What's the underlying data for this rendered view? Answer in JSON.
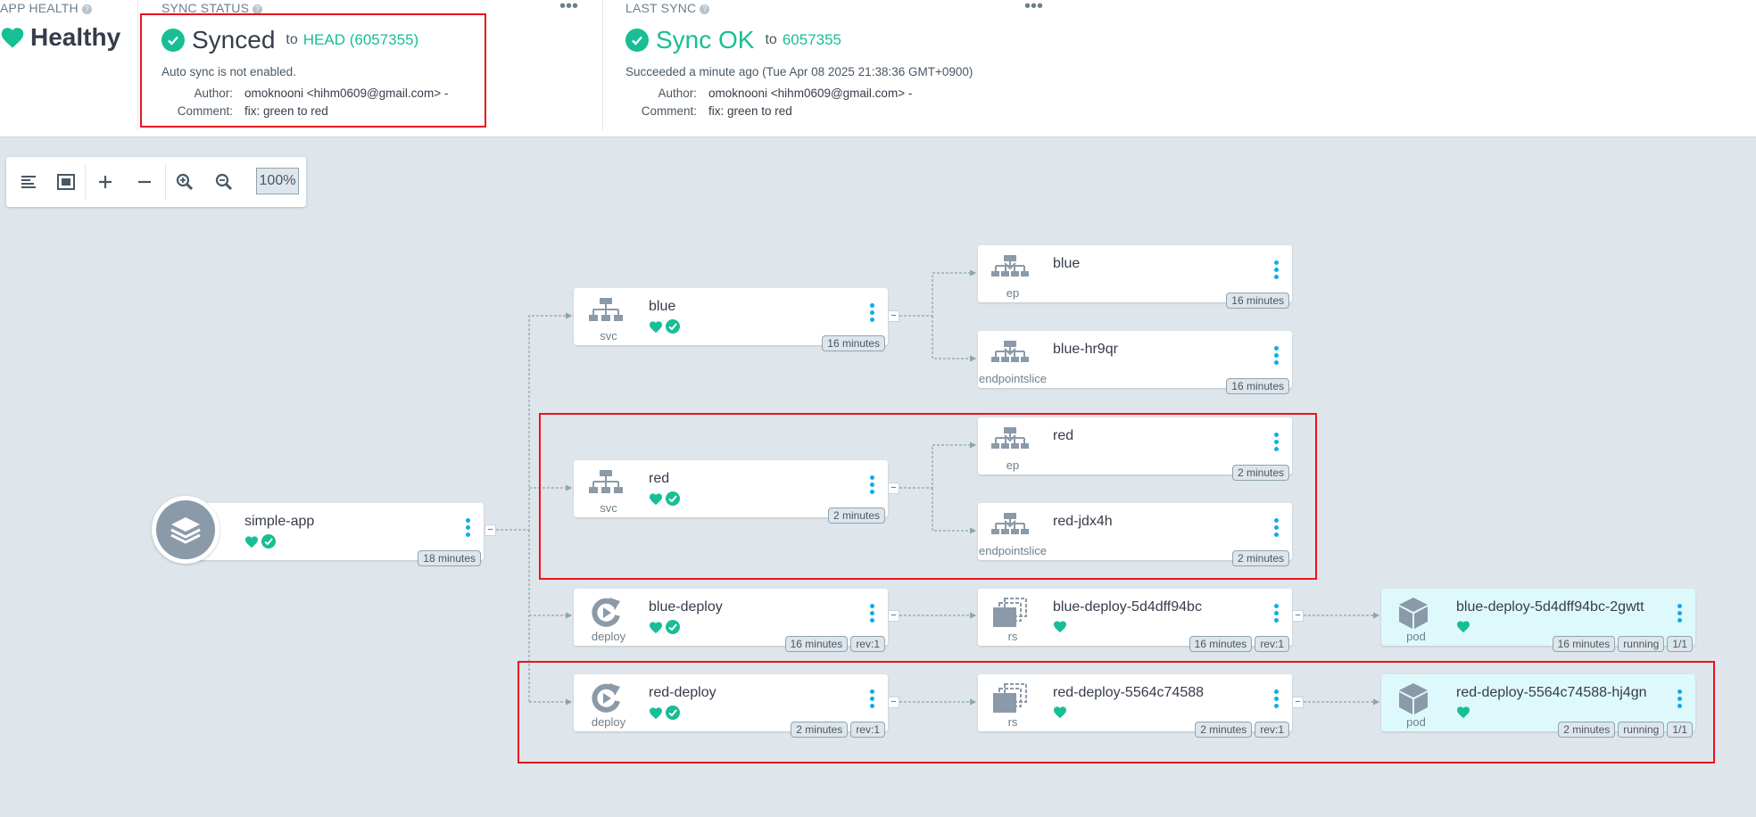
{
  "app_health": {
    "label": "APP HEALTH",
    "value": "Healthy",
    "color": "#18be94"
  },
  "sync_status": {
    "label": "SYNC STATUS",
    "value": "Synced",
    "to_prefix": "to",
    "to_value": "HEAD (6057355)",
    "auto_sync": "Auto sync is not enabled.",
    "author_label": "Author:",
    "author_value": "omoknooni <hihm0609@gmail.com> -",
    "comment_label": "Comment:",
    "comment_value": "fix: green to red"
  },
  "last_sync": {
    "label": "LAST SYNC",
    "value": "Sync OK",
    "to_prefix": "to",
    "to_value": "6057355",
    "succeeded": "Succeeded a minute ago (Tue Apr 08 2025 21:38:36 GMT+0900)",
    "author_label": "Author:",
    "author_value": "omoknooni <hihm0609@gmail.com> -",
    "comment_label": "Comment:",
    "comment_value": "fix: green to red"
  },
  "toolbar": {
    "zoom": "100%",
    "icons": [
      "list-view-icon",
      "fit-view-icon",
      "expand-icon",
      "collapse-icon",
      "zoom-in-icon",
      "zoom-out-icon"
    ]
  },
  "tree": {
    "app": {
      "name": "simple-app",
      "age": "18 minutes"
    },
    "svc_blue": {
      "name": "blue",
      "kind": "svc",
      "age": "16 minutes"
    },
    "ep_blue": {
      "name": "blue",
      "kind": "ep",
      "age": "16 minutes"
    },
    "eps_blue": {
      "name": "blue-hr9qr",
      "kind": "endpointslice",
      "age": "16 minutes"
    },
    "svc_red": {
      "name": "red",
      "kind": "svc",
      "age": "2 minutes"
    },
    "ep_red": {
      "name": "red",
      "kind": "ep",
      "age": "2 minutes"
    },
    "eps_red": {
      "name": "red-jdx4h",
      "kind": "endpointslice",
      "age": "2 minutes"
    },
    "deploy_blue": {
      "name": "blue-deploy",
      "kind": "deploy",
      "age": "16 minutes",
      "rev": "rev:1"
    },
    "rs_blue": {
      "name": "blue-deploy-5d4dff94bc",
      "kind": "rs",
      "age": "16 minutes",
      "rev": "rev:1"
    },
    "pod_blue": {
      "name": "blue-deploy-5d4dff94bc-2gwtt",
      "kind": "pod",
      "age": "16 minutes",
      "state": "running",
      "ready": "1/1"
    },
    "deploy_red": {
      "name": "red-deploy",
      "kind": "deploy",
      "age": "2 minutes",
      "rev": "rev:1"
    },
    "rs_red": {
      "name": "red-deploy-5564c74588",
      "kind": "rs",
      "age": "2 minutes",
      "rev": "rev:1"
    },
    "pod_red": {
      "name": "red-deploy-5564c74588-hj4gn",
      "kind": "pod",
      "age": "2 minutes",
      "state": "running",
      "ready": "1/1"
    }
  },
  "colors": {
    "healthy": "#18be94",
    "highlight": "#e8141e",
    "menu_dots": "#0dadea"
  }
}
